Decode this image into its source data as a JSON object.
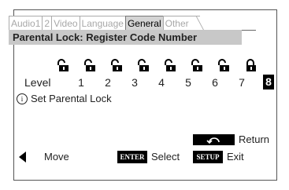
{
  "tabs": [
    "Audio1",
    "2",
    "Video",
    "Language",
    "General",
    "Other"
  ],
  "active_tab": "General",
  "heading": "Parental Lock: Register Code Number",
  "level": {
    "label": "Level",
    "values": [
      "1",
      "2",
      "3",
      "4",
      "5",
      "6",
      "7",
      "8"
    ],
    "selected": "8"
  },
  "info": {
    "icon": "info-icon",
    "text": "Set Parental Lock"
  },
  "footer": {
    "return_label": "Return",
    "move_label": "Move",
    "enter_key": "ENTER",
    "select_label": "Select",
    "setup_key": "SETUP",
    "exit_label": "Exit"
  },
  "colors": {
    "heading_bg": "#c8c8c8",
    "active_tab_bg": "#d4d4d4",
    "highlight": "#000000"
  }
}
